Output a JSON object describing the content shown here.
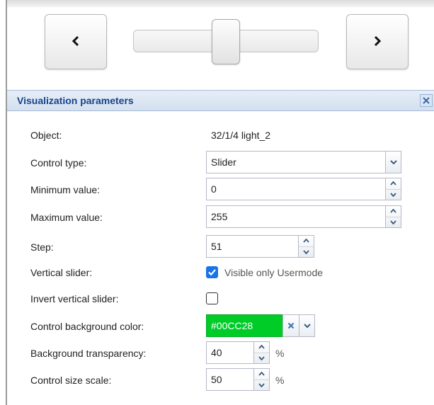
{
  "colors": {
    "accent": "#15428b",
    "checkbox": "#1a73e8",
    "control_background": "#00CC28"
  },
  "preview": {
    "prev_icon": "chevron-left-icon",
    "next_icon": "chevron-right-icon",
    "slider_level": 0.5
  },
  "panel": {
    "title": "Visualization parameters",
    "close_icon": "close-icon",
    "object": {
      "label": "Object:",
      "value": "32/1/4 light_2"
    },
    "control_type": {
      "label": "Control type:",
      "value": "Slider"
    },
    "minimum_value": {
      "label": "Minimum value:",
      "value": "0"
    },
    "maximum_value": {
      "label": "Maximum value:",
      "value": "255"
    },
    "step": {
      "label": "Step:",
      "value": "51"
    },
    "vertical_slider": {
      "label": "Vertical slider:",
      "checked": true,
      "option_label": "Visible only Usermode"
    },
    "invert_vertical_slider": {
      "label": "Invert vertical slider:",
      "checked": false
    },
    "control_background_color": {
      "label": "Control background color:",
      "value": "#00CC28"
    },
    "background_transparency": {
      "label": "Background transparency:",
      "value": "40",
      "unit": "%"
    },
    "control_size_scale": {
      "label": "Control size scale:",
      "value": "50",
      "unit": "%"
    }
  }
}
